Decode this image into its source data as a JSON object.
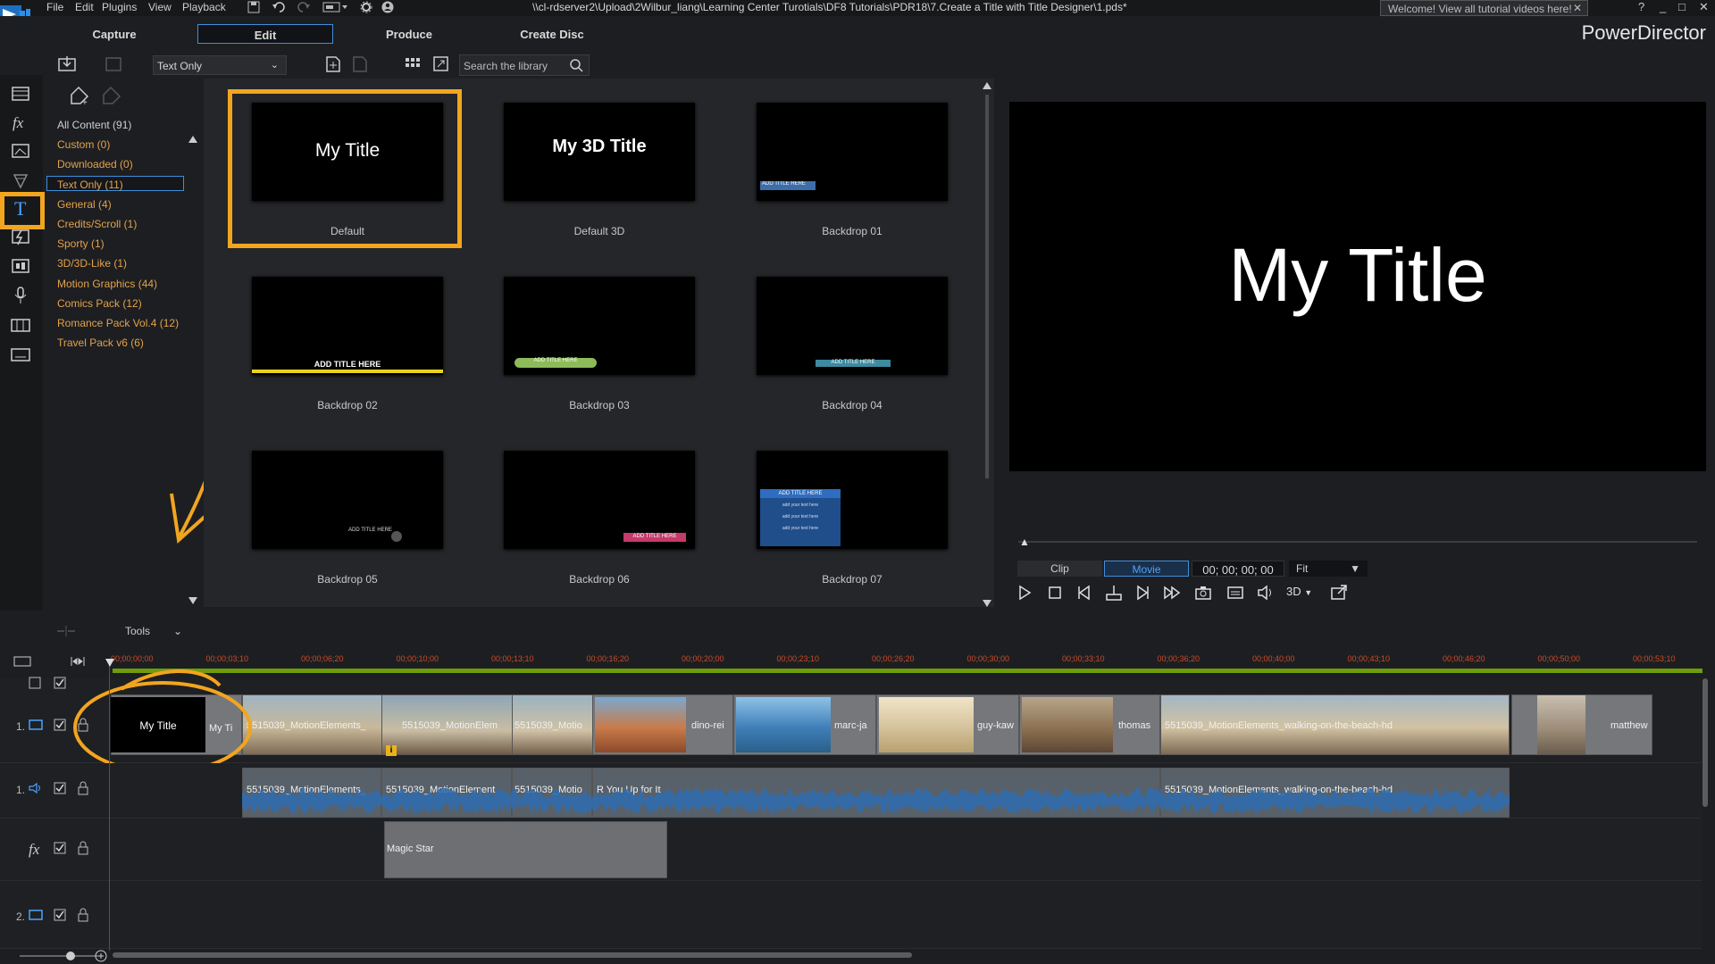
{
  "menu": [
    "File",
    "Edit",
    "Plugins",
    "View",
    "Playback"
  ],
  "file_path": "\\\\cl-rdserver2\\Upload\\2Wilbur_liang\\Learning Center Turotials\\DF8 Tutorials\\PDR18\\7.Create a Title with Title Designer\\1.pds*",
  "welcome": "Welcome! View all tutorial videos here!",
  "window_controls": [
    "?",
    "_",
    "□",
    "✕"
  ],
  "tabs": [
    "Capture",
    "Edit",
    "Produce",
    "Create Disc"
  ],
  "brand": "PowerDirector",
  "library": {
    "filter": "Text Only",
    "search_placeholder": "Search the library",
    "categories": [
      {
        "label": "All Content (91)"
      },
      {
        "label": "Custom  (0)"
      },
      {
        "label": "Downloaded  (0)"
      },
      {
        "label": "Text Only  (11)"
      },
      {
        "label": "General  (4)"
      },
      {
        "label": "Credits/Scroll  (1)"
      },
      {
        "label": "Sporty  (1)"
      },
      {
        "label": "3D/3D-Like  (1)"
      },
      {
        "label": "Motion Graphics  (44)"
      },
      {
        "label": "Comics Pack  (12)"
      },
      {
        "label": "Romance Pack Vol.4  (12)"
      },
      {
        "label": "Travel Pack v6  (6)"
      }
    ],
    "items": [
      {
        "name": "Default",
        "thumb_text": "My Title"
      },
      {
        "name": "Default 3D",
        "thumb_text": "My 3D Title"
      },
      {
        "name": "Backdrop 01",
        "thumb_text": "ADD TITLE HERE"
      },
      {
        "name": "Backdrop 02",
        "thumb_text": "ADD TITLE HERE"
      },
      {
        "name": "Backdrop 03",
        "thumb_text": "ADD TITLE HERE"
      },
      {
        "name": "Backdrop 04",
        "thumb_text": "ADD TITLE HERE"
      },
      {
        "name": "Backdrop 05",
        "thumb_text": "ADD TITLE HERE"
      },
      {
        "name": "Backdrop 06",
        "thumb_text": "ADD TITLE HERE"
      },
      {
        "name": "Backdrop 07",
        "thumb_text": "ADD TITLE HERE",
        "thumb_lines": [
          "add your text here",
          "add your text here",
          "add your text here"
        ]
      }
    ]
  },
  "preview": {
    "text": "My Title",
    "clip_label": "Clip",
    "movie_label": "Movie",
    "timecode": "00; 00; 00; 00",
    "fit": "Fit",
    "mode_3d": "3D"
  },
  "timeline": {
    "tools_label": "Tools",
    "ruler": [
      "00;00;00;00",
      "00;00;03;10",
      "00;00;06;20",
      "00;00;10;00",
      "00;00;13;10",
      "00;00;16;20",
      "00;00;20;00",
      "00;00;23;10",
      "00;00;26;20",
      "00;00;30;00",
      "00;00;33;10",
      "00;00;36;20",
      "00;00;40;00",
      "00;00;43;10",
      "00;00;46;20",
      "00;00;50;00",
      "00;00;53;10"
    ],
    "track_numbers": [
      "1.",
      "1.",
      "2."
    ],
    "fx_label": "fx",
    "title_clip": "My Title",
    "video_clips": [
      "My Ti",
      "5515039_MotionElements_",
      "5515039_MotionElem",
      "5515039_Motio",
      "dino-rei",
      "marc-ja",
      "guy-kaw",
      "thomas",
      "5515039_MotionElements_walking-on-the-beach-hd",
      "matthew"
    ],
    "audio_clips": [
      "5515039_MotionElements_",
      "5515039_MotionElement",
      "5515039_Motio",
      "R You Up for It",
      "5515039_MotionElements_walking-on-the-beach-hd"
    ],
    "effect_clip": "Magic Star",
    "marker": "i"
  },
  "colors": {
    "highlight": "#f2a51f",
    "accent": "#3f8edb",
    "category": "#e2a24b",
    "ruler": "#6f9c0c"
  }
}
